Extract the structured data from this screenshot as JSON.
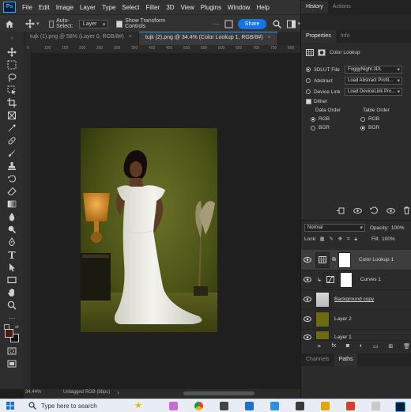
{
  "menu": {
    "app_badge": "Ps",
    "items": [
      "File",
      "Edit",
      "Image",
      "Layer",
      "Type",
      "Select",
      "Filter",
      "3D",
      "View",
      "Plugins",
      "Window",
      "Help"
    ]
  },
  "options": {
    "auto_select_label": "Auto-Select:",
    "auto_select_value": "Layer",
    "transform_label": "Show Transform Controls",
    "share_label": "Share"
  },
  "tabs": [
    {
      "label": "tujk (1).png @ 58% (Layer 0, RGB/8#)",
      "close": "×"
    },
    {
      "label": "tujk (2).png @ 34.4% (Color Lookup 1, RGB/8#)",
      "close": "×"
    }
  ],
  "ruler": {
    "ticks": [
      "0",
      "100",
      "150",
      "200",
      "250",
      "300",
      "350",
      "400",
      "450",
      "500",
      "550",
      "600",
      "650",
      "700",
      "750",
      "800"
    ]
  },
  "status": {
    "zoom": "34.44%",
    "profile": "Untagged RGB (8bpc)",
    "arrow": "›"
  },
  "right_panel": {
    "top_tabs": [
      "History",
      "Actions"
    ],
    "prop_tabs": [
      "Properties",
      "Info"
    ],
    "adjustment_title": "Color Lookup",
    "lut_file_label": "3DLUT File",
    "lut_file_value": "FoggyNight.3DL",
    "abstract_label": "Abstract",
    "abstract_value": "Load Abstract Profil...",
    "device_link_label": "Device Link",
    "device_link_value": "Load DeviceLink Pro...",
    "dither_label": "Dither",
    "data_order_label": "Data Order",
    "table_order_label": "Table Order",
    "rgb": "RGB",
    "bgr": "BGR",
    "data_order_selected": "RGB",
    "table_order_selected": "BGR"
  },
  "layers_panel": {
    "blend_mode": "Normal",
    "opacity_label": "Opacity:",
    "opacity_value": "100%",
    "lock_label": "Lock:",
    "fill_label": "Fill:",
    "fill_value": "100%",
    "layers": [
      {
        "name": "Color Lookup 1",
        "selected": true,
        "thumb": "adjustment",
        "mask": true
      },
      {
        "name": "Curves 1",
        "selected": false,
        "thumb": "adjustment",
        "mask": true
      },
      {
        "name": "Background copy",
        "selected": false,
        "thumb": "photo",
        "mask": false
      },
      {
        "name": "Layer 2",
        "selected": false,
        "thumb": "olive",
        "mask": false
      },
      {
        "name": "Layer 1",
        "selected": false,
        "thumb": "olive",
        "mask": false
      }
    ],
    "bottom_tabs": [
      "Channels",
      "Paths"
    ]
  },
  "taskbar": {
    "search_placeholder": "Type here to search"
  },
  "colors": {
    "accent": "#1473e6",
    "panel": "#2b2b2b",
    "backdrop": "#5a6120"
  }
}
